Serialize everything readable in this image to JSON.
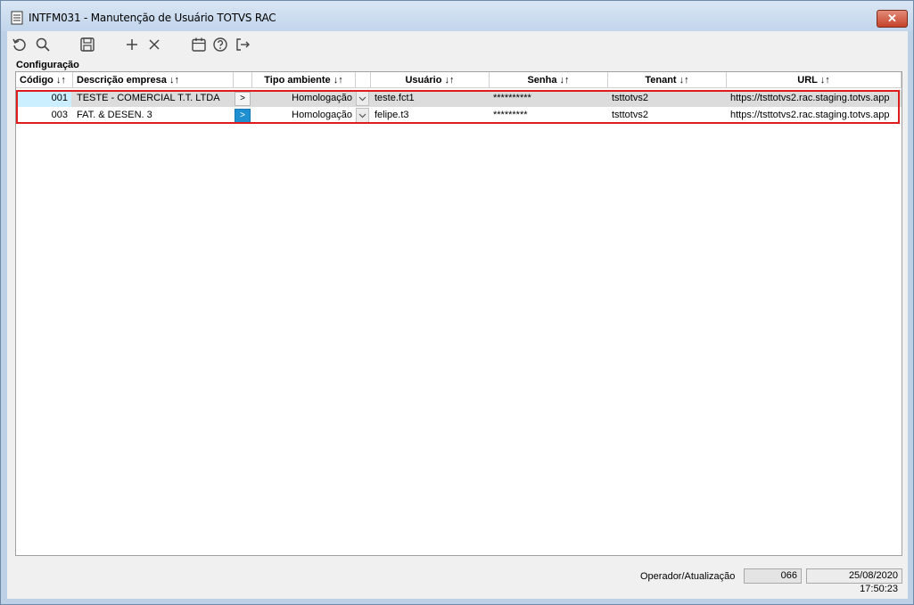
{
  "window": {
    "title": "INTFM031 - Manutenção de Usuário TOTVS RAC",
    "close_label": "✕"
  },
  "toolbar": {
    "buttons": [
      "refresh-icon",
      "search-icon",
      "save-icon",
      "add-icon",
      "delete-icon",
      "calendar-icon",
      "help-icon",
      "exit-icon"
    ]
  },
  "section": {
    "title": "Configuração"
  },
  "grid": {
    "columns": [
      "Código ↓↑",
      "Descrição empresa ↓↑",
      "",
      "Tipo ambiente ↓↑",
      "",
      "Usuário ↓↑",
      "Senha ↓↑",
      "Tenant ↓↑",
      "URL ↓↑"
    ],
    "rows": [
      {
        "codigo": "001",
        "empresa": "TESTE - COMERCIAL T.T. LTDA",
        "btn": ">",
        "tipo": "Homologação",
        "usuario": "teste.fct1",
        "senha": "**********",
        "tenant": "tsttotvs2",
        "url": "https://tsttotvs2.rac.staging.totvs.app"
      },
      {
        "codigo": "003",
        "empresa": "FAT. & DESEN. 3",
        "btn": ">",
        "tipo": "Homologação",
        "usuario": "felipe.t3",
        "senha": "*********",
        "tenant": "tsttotvs2",
        "url": "https://tsttotvs2.rac.staging.totvs.app"
      }
    ]
  },
  "footer": {
    "label": "Operador/Atualização",
    "operador": "066",
    "atualizacao": "25/08/2020 17:50:23"
  },
  "colors": {
    "highlight": "#e01b1b",
    "active_button": "#1e8fd0"
  }
}
